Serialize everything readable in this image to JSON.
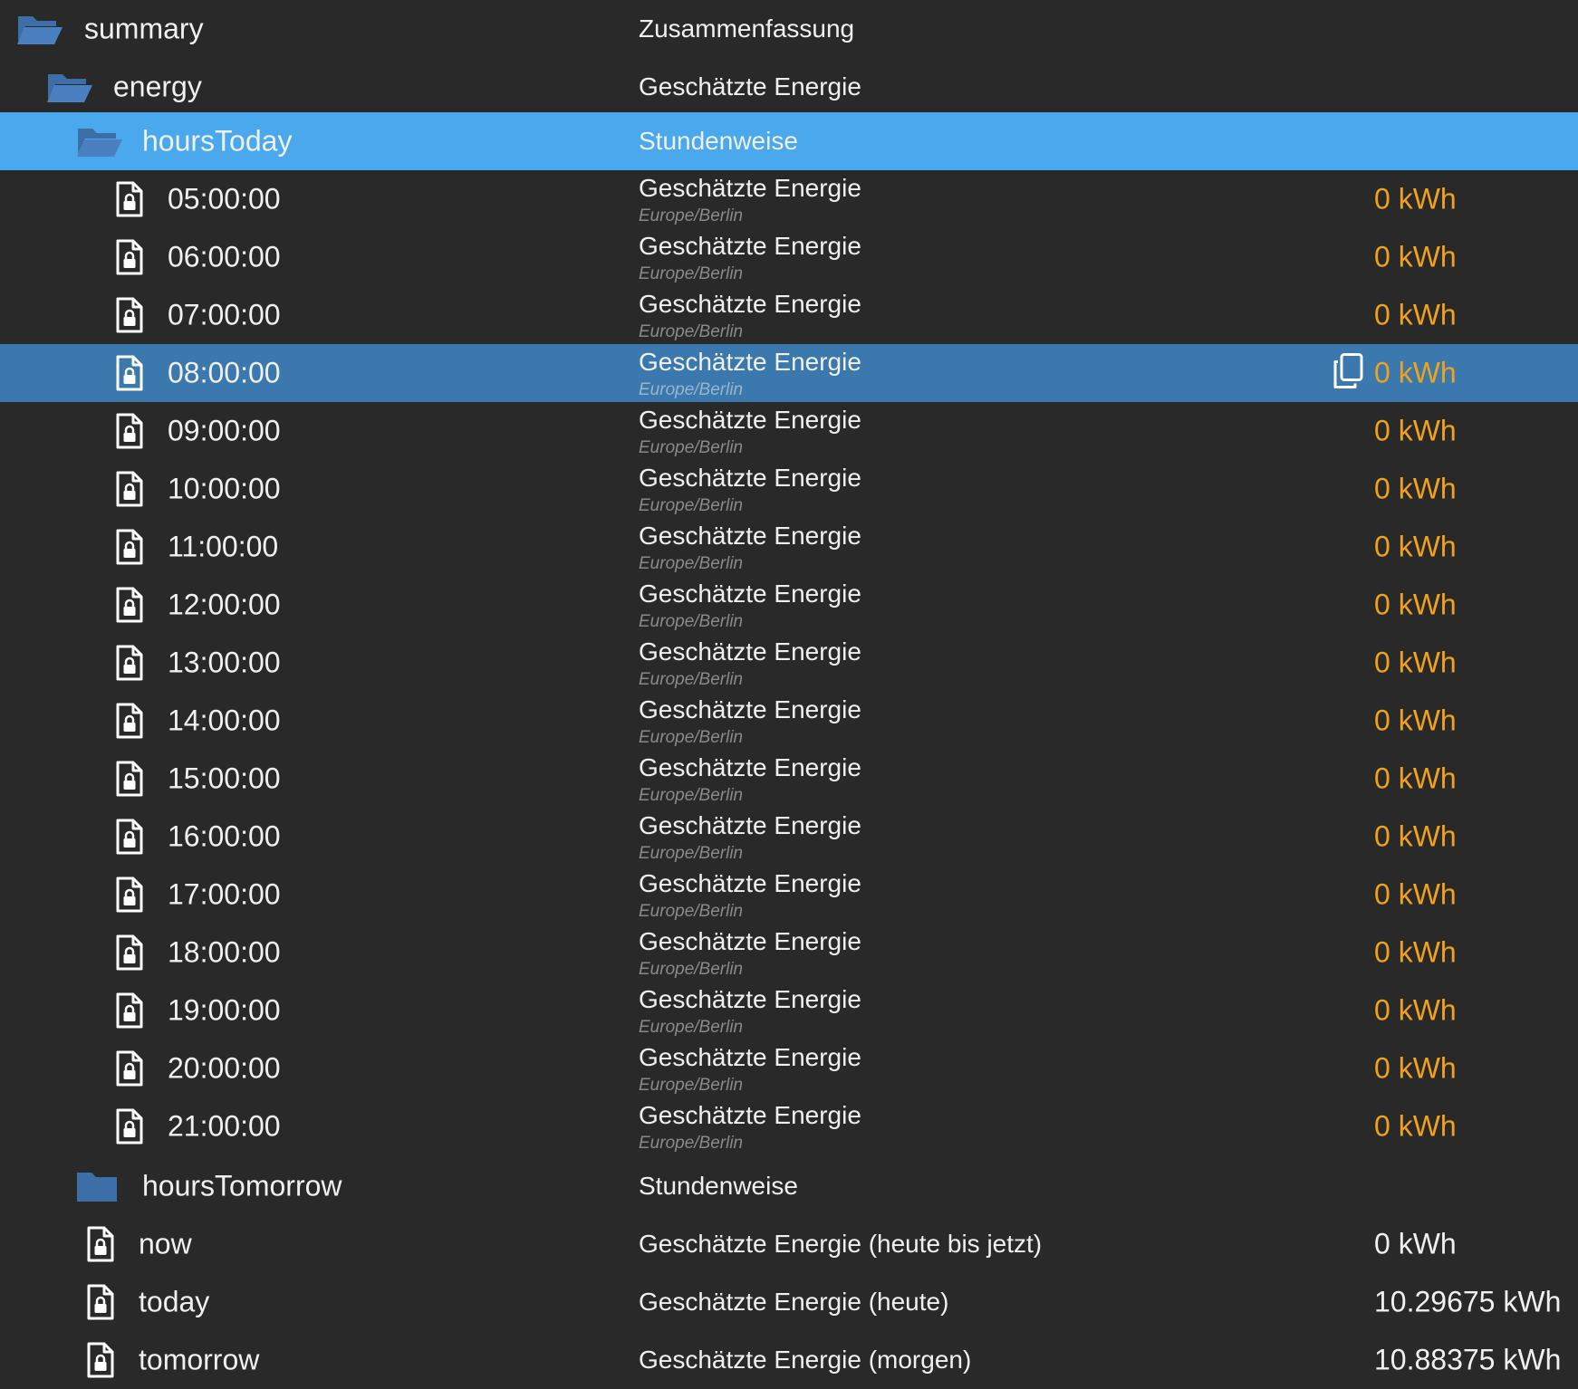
{
  "colors": {
    "background": "#292929",
    "folder_highlight": "#4aa8ec",
    "selected_row": "#3a78ad",
    "value_accent": "#f0a21c",
    "folder_icon": "#3d6ea8"
  },
  "tree": {
    "summary": {
      "name": "summary",
      "desc": "Zusammenfassung",
      "icon": "folder-open-icon"
    },
    "energy": {
      "name": "energy",
      "desc": "Geschätzte Energie",
      "icon": "folder-open-icon"
    },
    "hoursToday": {
      "name": "hoursToday",
      "desc": "Stundenweise",
      "icon": "folder-open-icon"
    },
    "hours": [
      {
        "time": "05:00:00",
        "desc": "Geschätzte Energie",
        "sub": "Europe/Berlin",
        "value": "0 kWh"
      },
      {
        "time": "06:00:00",
        "desc": "Geschätzte Energie",
        "sub": "Europe/Berlin",
        "value": "0 kWh"
      },
      {
        "time": "07:00:00",
        "desc": "Geschätzte Energie",
        "sub": "Europe/Berlin",
        "value": "0 kWh"
      },
      {
        "time": "08:00:00",
        "desc": "Geschätzte Energie",
        "sub": "Europe/Berlin",
        "value": "0 kWh",
        "selected": true
      },
      {
        "time": "09:00:00",
        "desc": "Geschätzte Energie",
        "sub": "Europe/Berlin",
        "value": "0 kWh"
      },
      {
        "time": "10:00:00",
        "desc": "Geschätzte Energie",
        "sub": "Europe/Berlin",
        "value": "0 kWh"
      },
      {
        "time": "11:00:00",
        "desc": "Geschätzte Energie",
        "sub": "Europe/Berlin",
        "value": "0 kWh"
      },
      {
        "time": "12:00:00",
        "desc": "Geschätzte Energie",
        "sub": "Europe/Berlin",
        "value": "0 kWh"
      },
      {
        "time": "13:00:00",
        "desc": "Geschätzte Energie",
        "sub": "Europe/Berlin",
        "value": "0 kWh"
      },
      {
        "time": "14:00:00",
        "desc": "Geschätzte Energie",
        "sub": "Europe/Berlin",
        "value": "0 kWh"
      },
      {
        "time": "15:00:00",
        "desc": "Geschätzte Energie",
        "sub": "Europe/Berlin",
        "value": "0 kWh"
      },
      {
        "time": "16:00:00",
        "desc": "Geschätzte Energie",
        "sub": "Europe/Berlin",
        "value": "0 kWh"
      },
      {
        "time": "17:00:00",
        "desc": "Geschätzte Energie",
        "sub": "Europe/Berlin",
        "value": "0 kWh"
      },
      {
        "time": "18:00:00",
        "desc": "Geschätzte Energie",
        "sub": "Europe/Berlin",
        "value": "0 kWh"
      },
      {
        "time": "19:00:00",
        "desc": "Geschätzte Energie",
        "sub": "Europe/Berlin",
        "value": "0 kWh"
      },
      {
        "time": "20:00:00",
        "desc": "Geschätzte Energie",
        "sub": "Europe/Berlin",
        "value": "0 kWh"
      },
      {
        "time": "21:00:00",
        "desc": "Geschätzte Energie",
        "sub": "Europe/Berlin",
        "value": "0 kWh"
      }
    ],
    "hoursTomorrow": {
      "name": "hoursTomorrow",
      "desc": "Stundenweise",
      "icon": "folder-closed-icon"
    },
    "states": [
      {
        "name": "now",
        "desc": "Geschätzte Energie (heute bis jetzt)",
        "value": "0 kWh"
      },
      {
        "name": "today",
        "desc": "Geschätzte Energie (heute)",
        "value": "10.29675 kWh"
      },
      {
        "name": "tomorrow",
        "desc": "Geschätzte Energie (morgen)",
        "value": "10.88375 kWh"
      }
    ]
  }
}
